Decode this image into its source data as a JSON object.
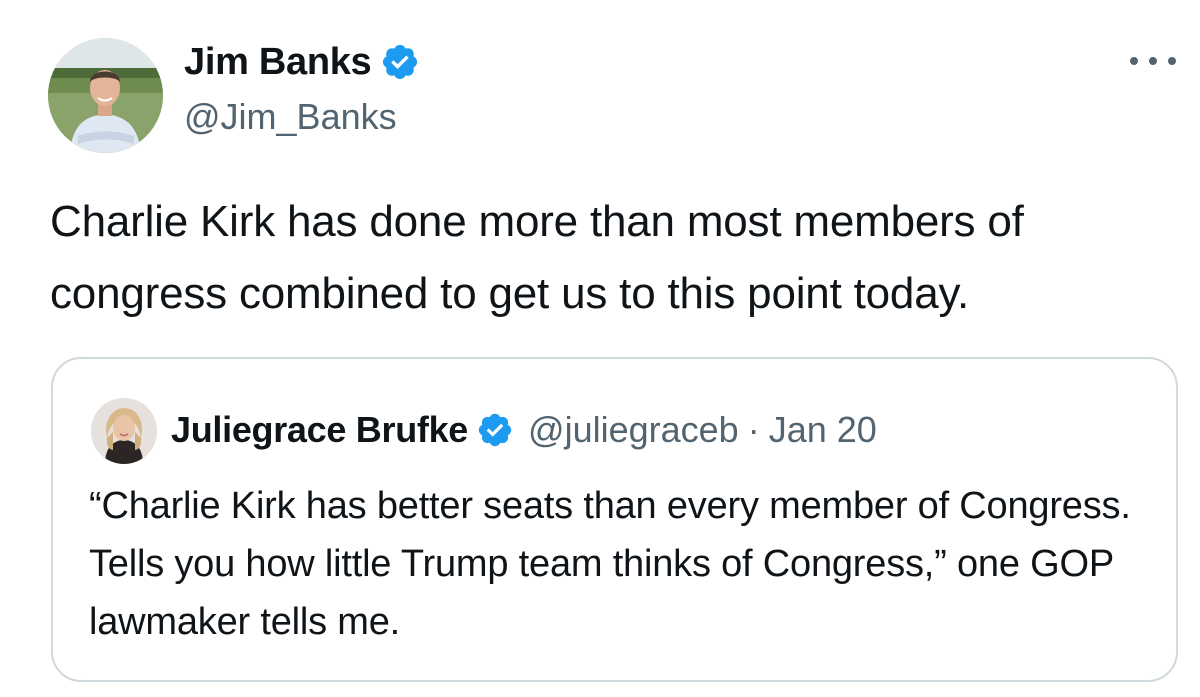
{
  "tweet": {
    "author": {
      "name": "Jim Banks",
      "handle": "@Jim_Banks"
    },
    "text": "Charlie Kirk has done more than most members of congress combined to get us to this point today.",
    "more_icon": "more-horizontal-icon"
  },
  "quote": {
    "author": {
      "name": "Juliegrace Brufke",
      "handle": "@juliegraceb"
    },
    "separator": "·",
    "date": "Jan 20",
    "text": "“Charlie Kirk has better seats than every member of Congress. Tells you how little Trump team thinks of Congress,” one GOP lawmaker tells me."
  },
  "colors": {
    "verified_blue": "#1d9bf0",
    "text_primary": "#0f1419",
    "text_secondary": "#536471",
    "border": "#cfd9de"
  }
}
